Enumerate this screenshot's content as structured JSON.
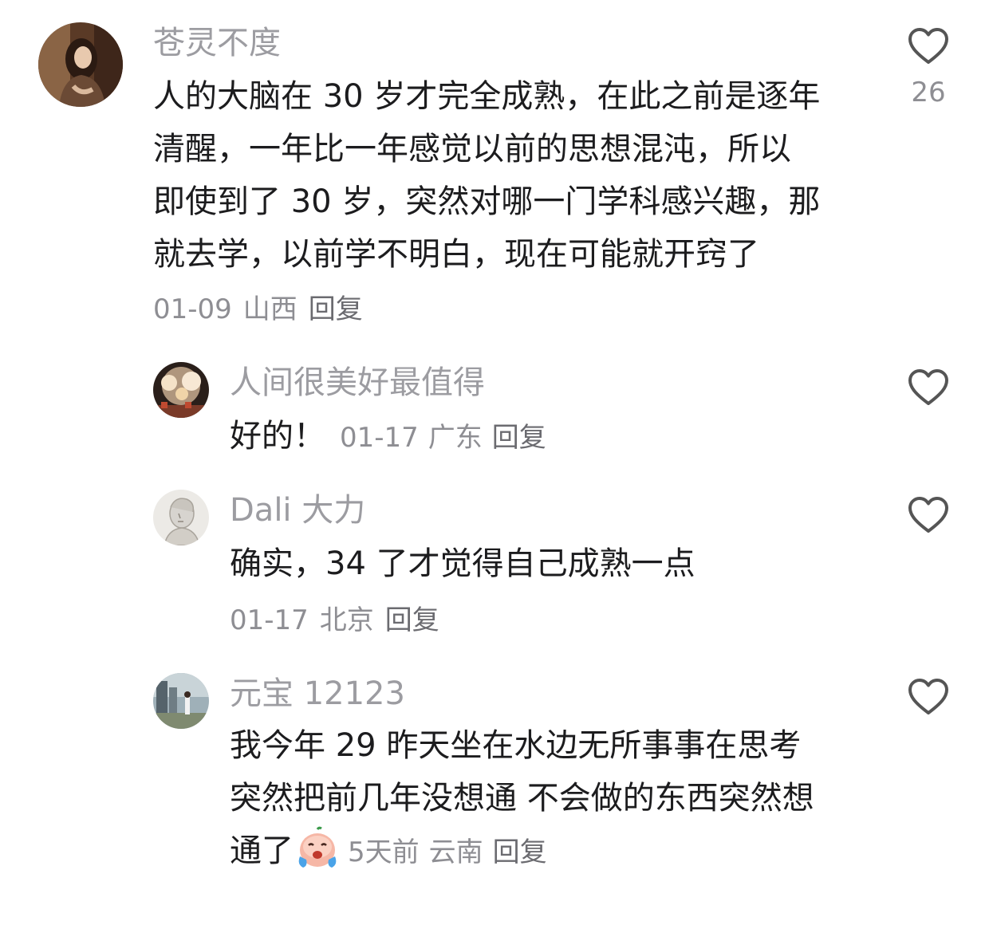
{
  "comments": [
    {
      "user": "苍灵不度",
      "lines": [
        "人的大脑在 30 岁才完全成熟，在此之前是逐年",
        "清醒，一年比一年感觉以前的思想混沌，所以",
        "即使到了 30 岁，突然对哪一门学科感兴趣，那",
        "就去学，以前学不明白，现在可能就开窍了"
      ],
      "date": "01-09",
      "location": "山西",
      "reply": "回复",
      "likes": "26",
      "avatar_icon": "portrait-woman-avatar"
    },
    {
      "user": "人间很美好最值得",
      "text": "好的！",
      "date": "01-17",
      "location": "广东",
      "reply": "回复",
      "avatar_icon": "fireworks-avatar"
    },
    {
      "user": "Dali 大力",
      "text": "确实，34 了才觉得自己成熟一点",
      "date": "01-17",
      "location": "北京",
      "reply": "回复",
      "avatar_icon": "statue-bust-avatar"
    },
    {
      "user": "元宝 12123",
      "lines": [
        "我今年 29 昨天坐在水边无所事事在思考",
        "突然把前几年没想通 不会做的东西突然想",
        "通了"
      ],
      "emoji": "crying-face-emoji",
      "date": "5天前",
      "location": "云南",
      "reply": "回复",
      "avatar_icon": "street-photo-avatar"
    }
  ],
  "colors": {
    "username": "#9c9ca1",
    "text": "#1c1c1e",
    "meta": "#8e8e93",
    "heart_stroke": "#555555"
  }
}
